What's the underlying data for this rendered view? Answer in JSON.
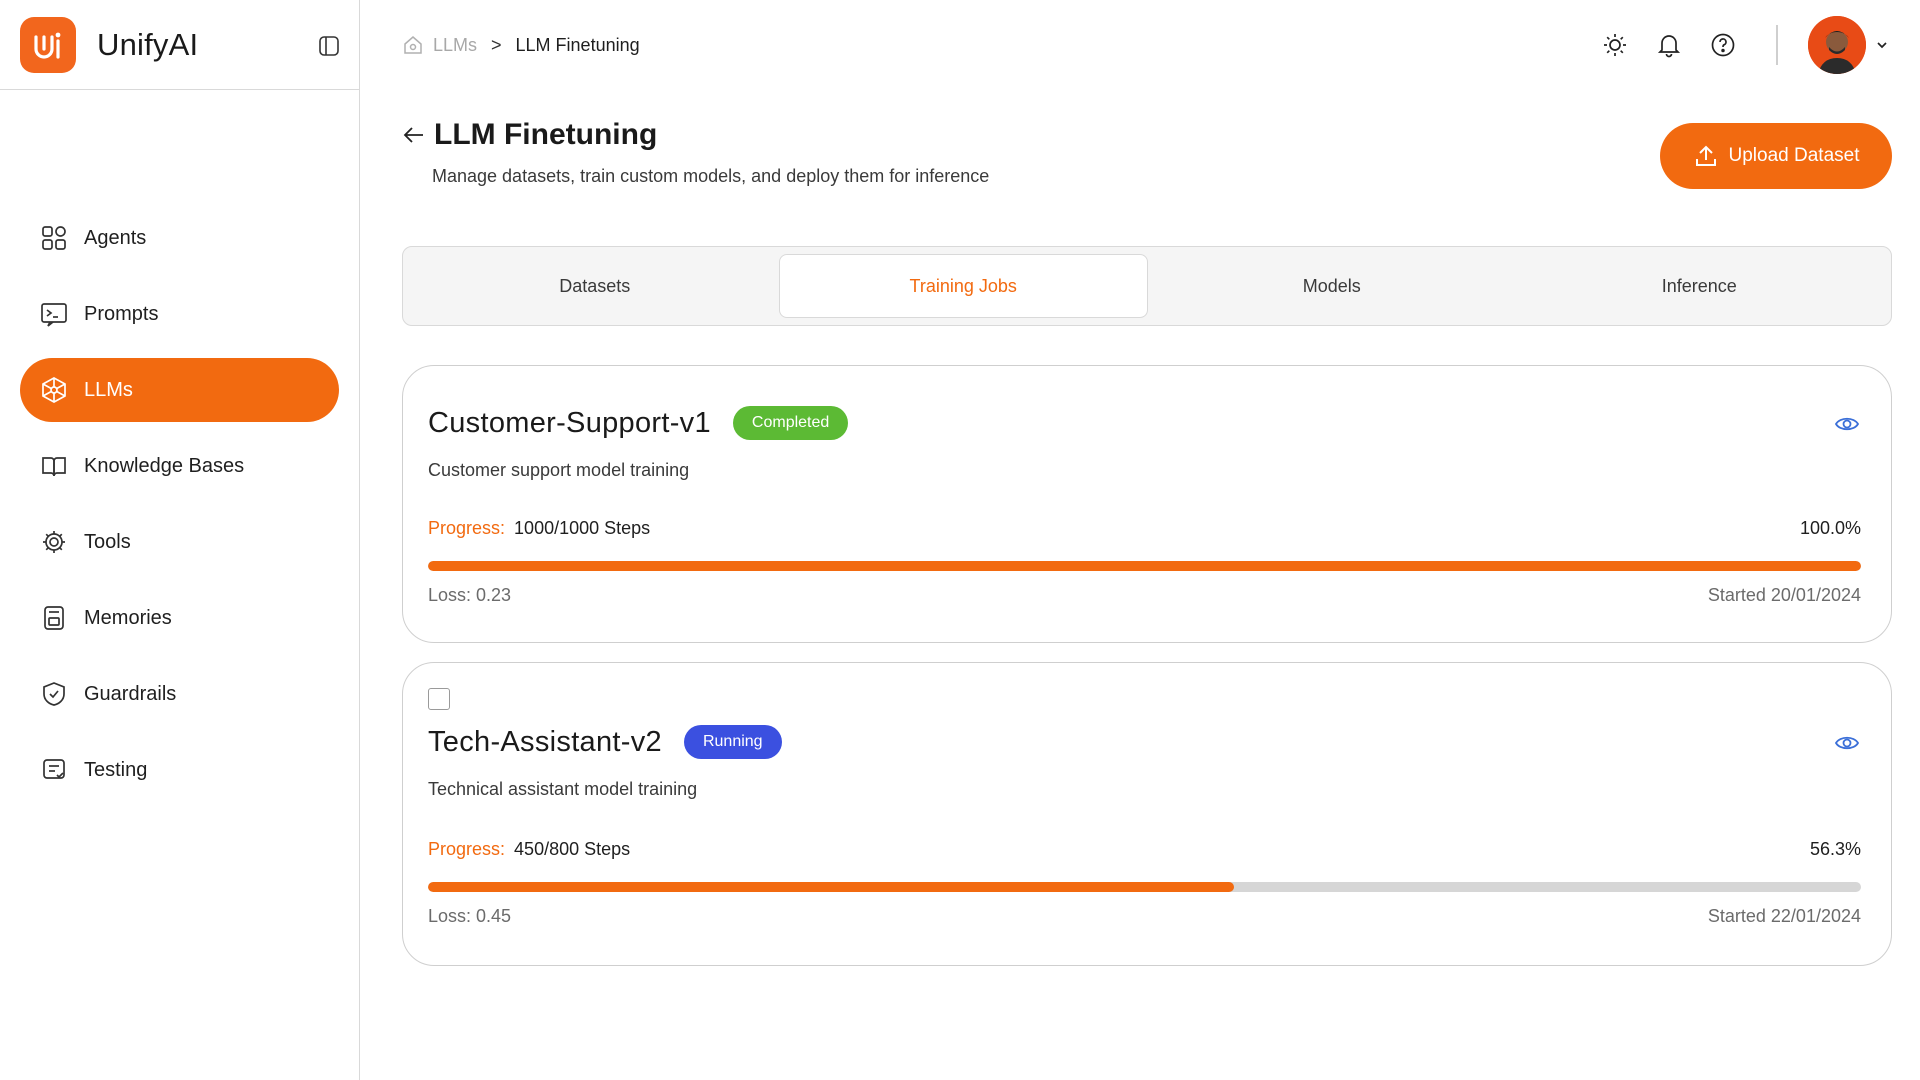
{
  "brand": {
    "name": "UnifyAI",
    "accent": "#f26a10"
  },
  "sidebar": {
    "items": [
      {
        "label": "Agents",
        "icon": "grid-icon",
        "active": false
      },
      {
        "label": "Prompts",
        "icon": "terminal-icon",
        "active": false
      },
      {
        "label": "LLMs",
        "icon": "cube-network-icon",
        "active": true
      },
      {
        "label": "Knowledge Bases",
        "icon": "book-icon",
        "active": false
      },
      {
        "label": "Tools",
        "icon": "gear-tools-icon",
        "active": false
      },
      {
        "label": "Memories",
        "icon": "memory-card-icon",
        "active": false
      },
      {
        "label": "Guardrails",
        "icon": "shield-icon",
        "active": false
      },
      {
        "label": "Testing",
        "icon": "checklist-icon",
        "active": false
      }
    ]
  },
  "breadcrumb": {
    "parent": "LLMs",
    "separator": ">",
    "current": "LLM Finetuning"
  },
  "header": {
    "title": "LLM Finetuning",
    "subtitle": "Manage datasets, train custom models, and deploy them for inference",
    "upload_label": "Upload Dataset"
  },
  "tabs": [
    {
      "label": "Datasets",
      "active": false
    },
    {
      "label": "Training Jobs",
      "active": true
    },
    {
      "label": "Models",
      "active": false
    },
    {
      "label": "Inference",
      "active": false
    }
  ],
  "jobs": [
    {
      "name": "Customer-Support-v1",
      "status": "Completed",
      "status_color": "#5cba34",
      "description": "Customer support model training",
      "progress_label": "Progress:",
      "steps": "1000/1000 Steps",
      "percent": "100.0%",
      "progress": 1.0,
      "loss": "Loss: 0.23",
      "started": "Started 20/01/2024"
    },
    {
      "name": "Tech-Assistant-v2",
      "status": "Running",
      "status_color": "#3b50e0",
      "description": "Technical assistant model training",
      "progress_label": "Progress:",
      "steps": "450/800 Steps",
      "percent": "56.3%",
      "progress": 0.5625,
      "loss": "Loss: 0.45",
      "started": "Started 22/01/2024"
    }
  ]
}
